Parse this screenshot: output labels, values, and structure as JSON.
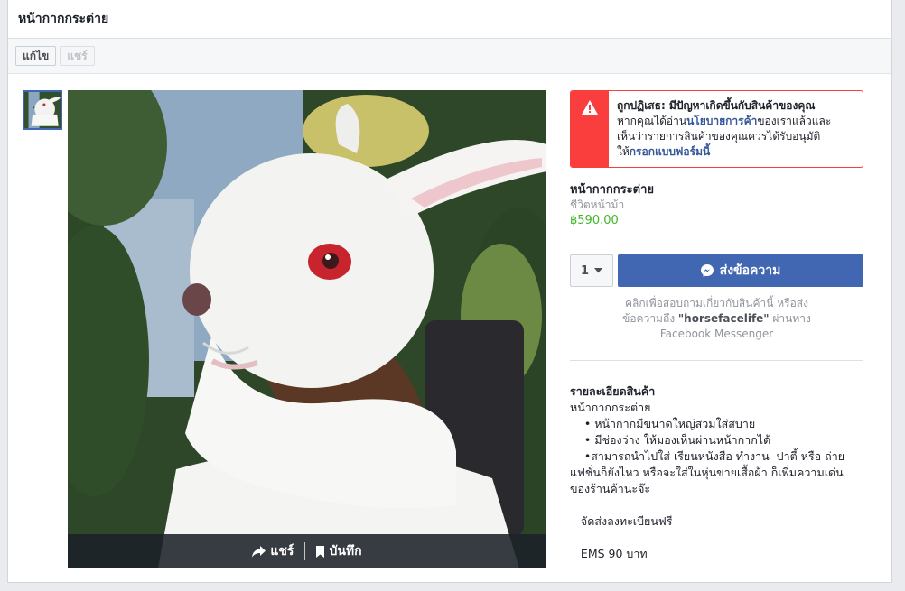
{
  "dialog": {
    "title": "หน้ากากกระต่าย"
  },
  "toolbar": {
    "edit_label": "แก้ไข",
    "share_label": "แชร์"
  },
  "photo_actions": {
    "share_label": "แชร์",
    "save_label": "บันทึก"
  },
  "alert": {
    "line1": "ถูกปฏิเสธ: มีปัญหาเกิดขึ้นกับสินค้าของคุณ",
    "line2_pre": "หากคุณได้อ่าน",
    "line2_link": "นโยบายการค้า",
    "line2_post": "ของเราแล้วและ",
    "line3": "เห็นว่ารายการสินค้าของคุณควรได้รับอนุมัติ",
    "line4_pre": "ให้",
    "line4_link": "กรอกแบบฟอร์มนี้"
  },
  "product": {
    "title": "หน้ากากกระต่าย",
    "seller": "ชีวิตหน้าม้า",
    "price": "฿590.00"
  },
  "purchase": {
    "quantity": "1",
    "send_label": "ส่งข้อความ",
    "help_line1": "คลิกเพื่อสอบถามเกี่ยวกับสินค้านี้ หรือส่ง",
    "help_line2_pre": "ข้อความถึง ",
    "help_page": "\"horsefacelife\"",
    "help_line2_post": " ผ่านทาง",
    "help_line3": "Facebook Messenger"
  },
  "details": {
    "heading": "รายละเอียดสินค้า",
    "lines": [
      "หน้ากากกระต่าย",
      "    • หน้ากากมีขนาดใหญ่สวมใส่สบาย",
      "    • มีช่องว่าง ให้มองเห็นผ่านหน้ากากได้",
      "    •สามารถนำไปใส่ เรียนหนังสือ ทำงาน  ปาตี้ หรือ ถ่าย",
      "แฟชั่นก็ยังไหว หรือจะใส่ในหุ่นขายเสื้อผ้า ก็เพิ่มความเด่น",
      "ของร้านค้านะจ๊ะ",
      "",
      "   จัดส่งลงทะเบียนฟรี",
      "",
      "   EMS 90 บาท"
    ]
  },
  "colors": {
    "accent": "#4267b2",
    "alert": "#fa3e3e",
    "price": "#42b72a"
  }
}
